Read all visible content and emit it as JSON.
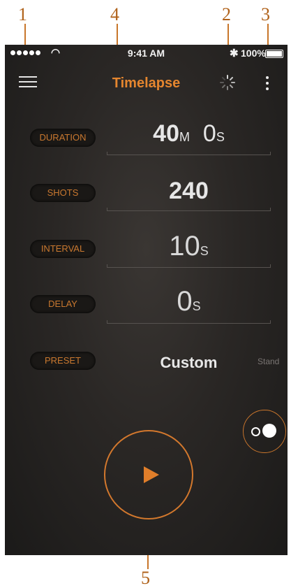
{
  "callouts": {
    "c1": "1",
    "c2": "2",
    "c3": "3",
    "c4": "4",
    "c5": "5"
  },
  "status_bar": {
    "time": "9:41 AM",
    "battery": "100%"
  },
  "header": {
    "title": "Timelapse"
  },
  "rows": {
    "duration": {
      "label": "DURATION",
      "minutes": "40",
      "minutes_unit": "M",
      "seconds": "0",
      "seconds_unit": "S"
    },
    "shots": {
      "label": "SHOTS",
      "value": "240"
    },
    "interval": {
      "label": "INTERVAL",
      "value": "10",
      "unit": "S"
    },
    "delay": {
      "label": "DELAY",
      "value": "0",
      "unit": "S"
    },
    "preset": {
      "label": "PRESET",
      "value": "Custom",
      "next": "Stand"
    }
  },
  "colors": {
    "accent": "#e5862f",
    "background": "#2a2725"
  },
  "icons": {
    "menu": "hamburger-menu-icon",
    "spinner": "bluetooth-activity-spinner-icon",
    "more": "more-vertical-icon",
    "toggle": "toggle-icon",
    "play": "play-icon"
  }
}
